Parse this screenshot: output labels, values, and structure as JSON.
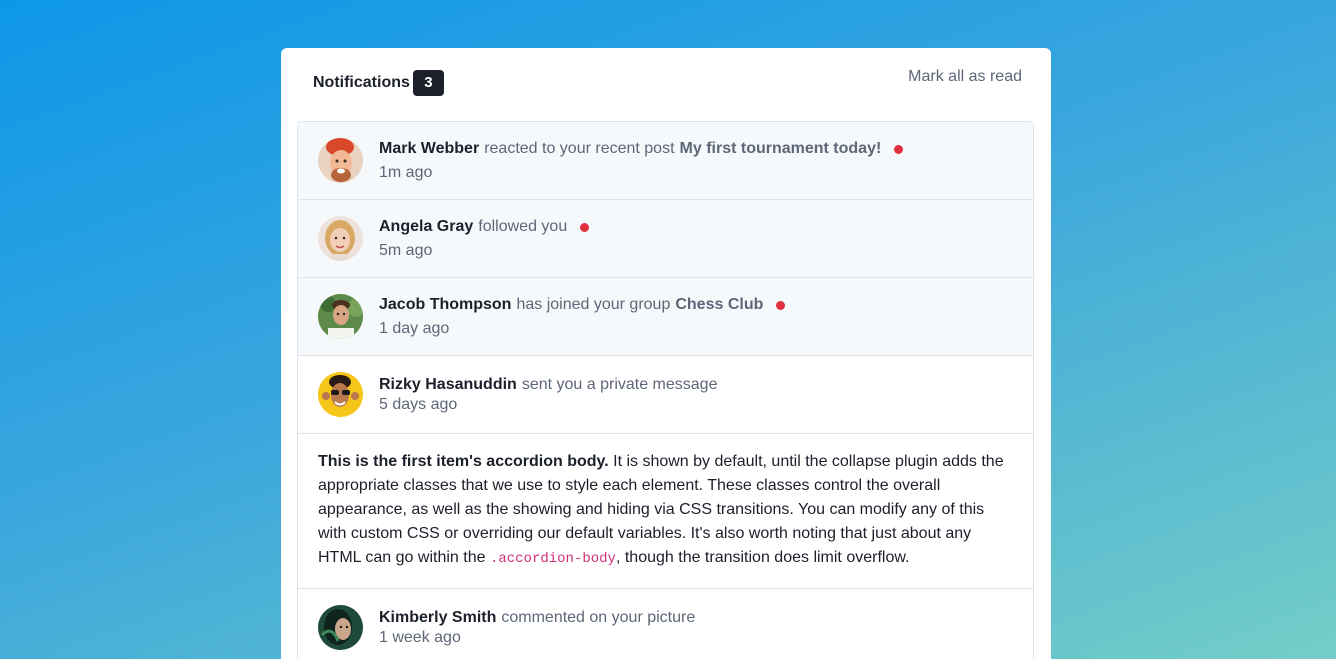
{
  "header": {
    "title": "Notifications",
    "count": "3",
    "mark_all_label": "Mark all as read"
  },
  "notifications": [
    {
      "name": "Mark Webber",
      "action": "reacted to your recent post",
      "target": "My first tournament today!",
      "time": "1m ago",
      "unread": true
    },
    {
      "name": "Angela Gray",
      "action": "followed you",
      "target": "",
      "time": "5m ago",
      "unread": true
    },
    {
      "name": "Jacob Thompson",
      "action": "has joined your group",
      "target": "Chess Club",
      "time": "1 day ago",
      "unread": true
    },
    {
      "name": "Rizky Hasanuddin",
      "action": "sent you a private message",
      "target": "",
      "time": "5 days ago",
      "unread": false
    },
    {
      "name": "Kimberly Smith",
      "action": "commented on your picture",
      "target": "",
      "time": "1 week ago",
      "unread": false
    }
  ],
  "accordion": {
    "bold": "This is the first item's accordion body.",
    "text_1": " It is shown by default, until the collapse plugin adds the appropriate classes that we use to style each element. These classes control the overall appearance, as well as the showing and hiding via CSS transitions. You can modify any of this with custom CSS or overriding our default variables. It's also worth noting that just about any HTML can go within the ",
    "code": ".accordion-body",
    "text_2": ", though the transition does limit overflow."
  },
  "colors": {
    "unread_dot": "#e0303f",
    "dark_text": "#1c202b",
    "muted_text": "#5e6778",
    "unread_bg": "#f6f9fc",
    "code": "#d2307c"
  }
}
